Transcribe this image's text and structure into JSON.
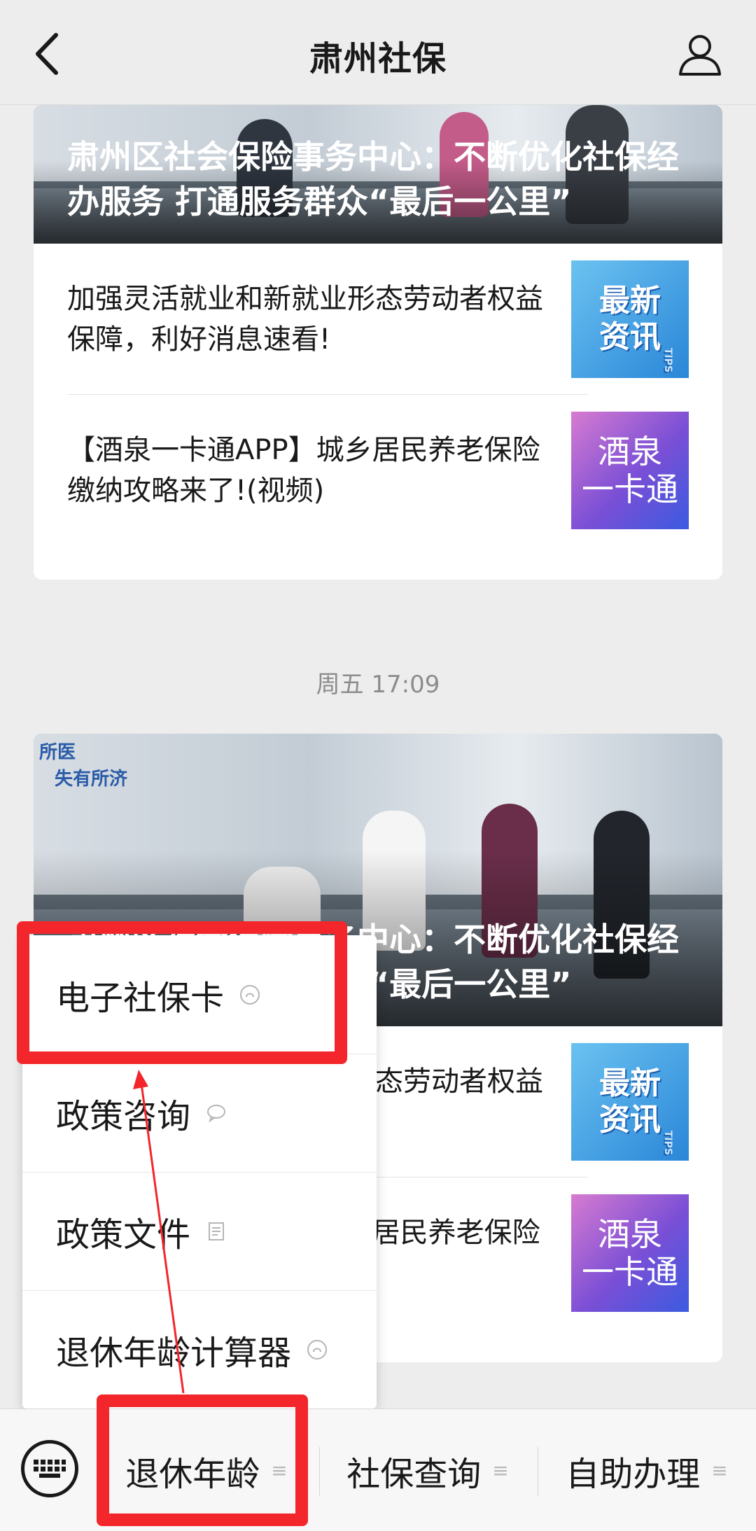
{
  "header": {
    "title": "肃州社保"
  },
  "card1": {
    "headline": "肃州区社会保险事务中心：不断优化社保经办服务 打通服务群众“最后一公里”",
    "items": [
      {
        "text": "加强灵活就业和新就业形态劳动者权益保障，利好消息速看!",
        "thumb_line1": "最新",
        "thumb_line2": "资讯",
        "thumb_tag": "TIPS"
      },
      {
        "text": "【酒泉一卡通APP】城乡居民养老保险缴纳攻略来了!(视频)",
        "thumb_line1": "酒泉",
        "thumb_line2": "一卡通"
      }
    ]
  },
  "timestamp": "周五 17:09",
  "card2": {
    "headline": "肃州区社会保险事务中心：不断优化社保经办服务 打通服务群众“最后一公里”",
    "sign1": "所医",
    "sign2": "失有所济",
    "items": [
      {
        "text": "加强灵活就业和新就业形态劳动者权益保障，利好消息速看!",
        "thumb_line1": "最新",
        "thumb_line2": "资讯",
        "thumb_tag": "TIPS"
      },
      {
        "text": "【酒泉一卡通APP】城乡居民养老保险缴纳攻略来了!(视频)",
        "thumb_line1": "酒泉",
        "thumb_line2": "一卡通"
      }
    ]
  },
  "menu": {
    "items": [
      {
        "label": "电子社保卡",
        "icon": "mini-program-icon"
      },
      {
        "label": "政策咨询",
        "icon": "message-icon"
      },
      {
        "label": "政策文件",
        "icon": "article-icon"
      },
      {
        "label": "退休年龄计算器",
        "icon": "mini-program-icon"
      }
    ]
  },
  "bottom_menu": {
    "tabs": [
      {
        "label": "退休年龄"
      },
      {
        "label": "社保查询"
      },
      {
        "label": "自助办理"
      }
    ]
  },
  "colors": {
    "highlight": "#f2262b",
    "background": "#ededed"
  }
}
